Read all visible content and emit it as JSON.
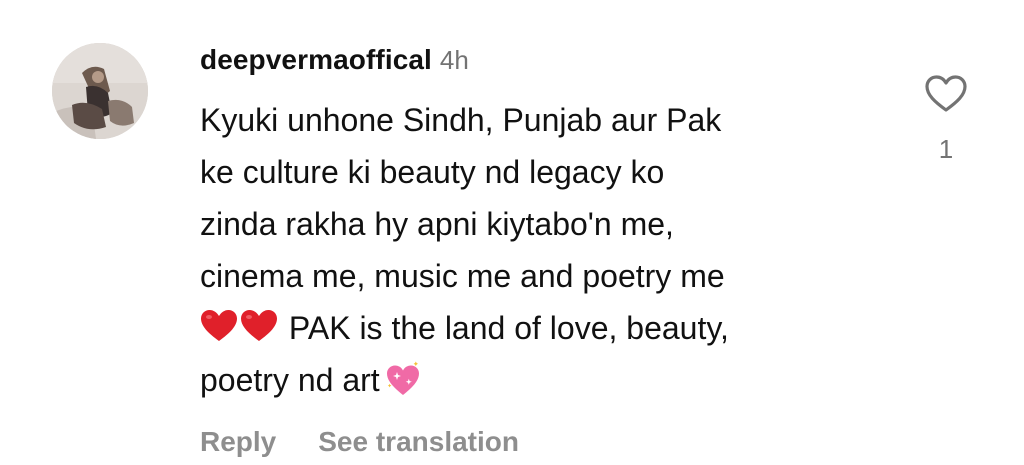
{
  "comment": {
    "username": "deepvermaoffical",
    "timestamp": "4h",
    "text_lines": [
      "Kyuki unhone Sindh, Punjab aur Pak",
      "ke culture ki beauty nd legacy ko",
      "zinda rakha hy apni kiytabo'n me,",
      "cinema me, music me and poetry me",
      "PAK is the land of love, beauty,",
      "poetry nd art"
    ],
    "emoji": {
      "hearts": "❤️❤️",
      "sparkling_heart": "💖"
    },
    "actions": {
      "reply_label": "Reply",
      "translate_label": "See translation"
    },
    "likes": {
      "count": "1",
      "icon": "heart-outline-icon"
    }
  },
  "colors": {
    "text": "#111111",
    "muted": "#737373",
    "action": "#8e8e8e",
    "heart_red": "#e0202a",
    "sparkle_pink": "#f06aa6"
  }
}
